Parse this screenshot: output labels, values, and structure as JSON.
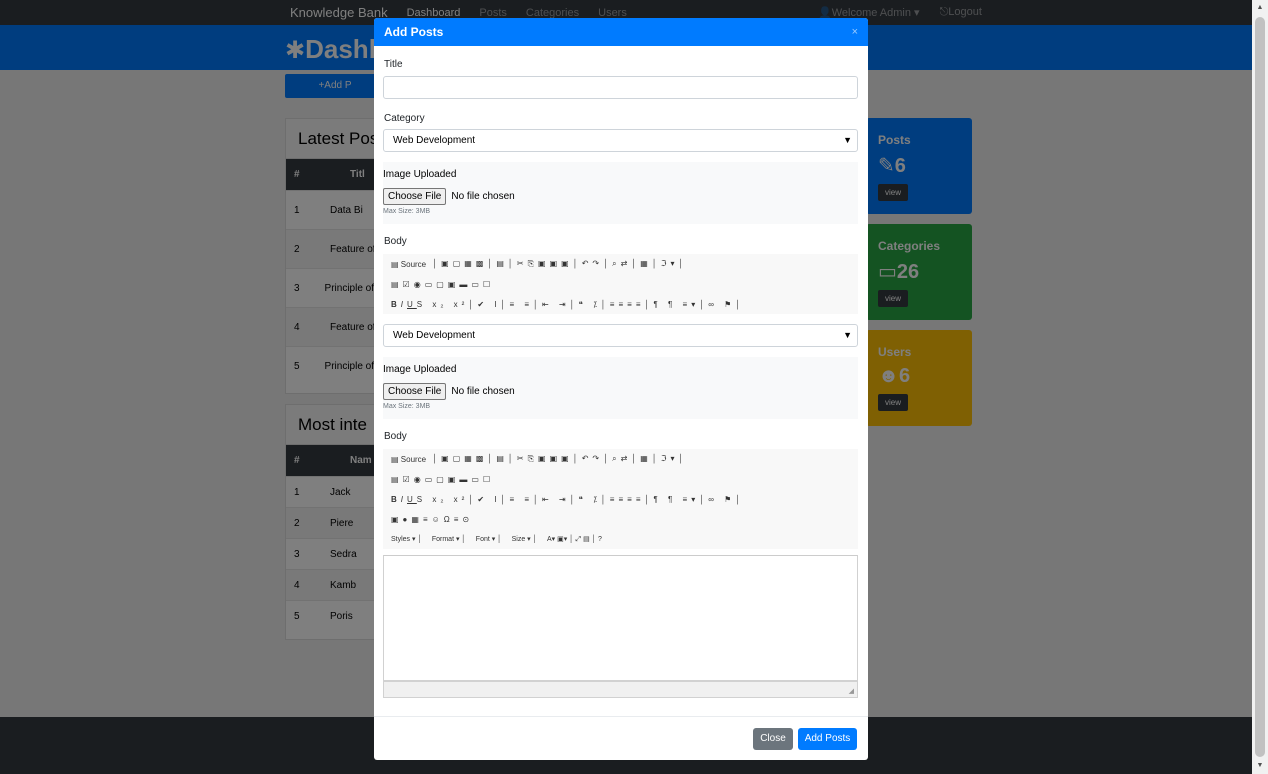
{
  "navbar": {
    "brand": "Knowledge Bank",
    "links": [
      "Dashboard",
      "Posts",
      "Categories",
      "Users"
    ],
    "welcome": "Welcome Admin",
    "logout": "Logout"
  },
  "header": {
    "title": "Dashb"
  },
  "add_button": "+Add P",
  "latest": {
    "heading": "Latest Pos",
    "col_hash": "#",
    "col_title": "Titl",
    "rows": [
      {
        "n": "1",
        "t": "Data Bi"
      },
      {
        "n": "2",
        "t": "Feature of"
      },
      {
        "n": "3",
        "t": "Principle of U"
      },
      {
        "n": "4",
        "t": "Feature of"
      },
      {
        "n": "5",
        "t": "Principle of U"
      }
    ]
  },
  "most": {
    "heading": "Most inte",
    "col_hash": "#",
    "col_name": "Nam",
    "rows": [
      {
        "n": "1",
        "t": "Jack"
      },
      {
        "n": "2",
        "t": "Piere"
      },
      {
        "n": "3",
        "t": "Sedra"
      },
      {
        "n": "4",
        "t": "Kamb"
      },
      {
        "n": "5",
        "t": "Poris"
      }
    ]
  },
  "stats": [
    {
      "label": "Posts",
      "num": "6",
      "view": "view",
      "color": "#007bff"
    },
    {
      "label": "Categories",
      "num": "26",
      "view": "view",
      "color": "#28a745"
    },
    {
      "label": "Users",
      "num": "6",
      "view": "view",
      "color": "#ffc107"
    }
  ],
  "modal": {
    "title": "Add Posts",
    "close_x": "×",
    "title_label": "Title",
    "title_value": "",
    "category_label": "Category",
    "category_value": "Web Development",
    "image_label": "Image Uploaded",
    "choose_file": "Choose File",
    "no_file": "No file chosen",
    "max_size": "Max Size: 3MB",
    "body_label": "Body",
    "source": "Source",
    "styles": "Styles",
    "format": "Format",
    "font": "Font",
    "size": "Size",
    "close_btn": "Close",
    "add_btn": "Add Posts"
  }
}
